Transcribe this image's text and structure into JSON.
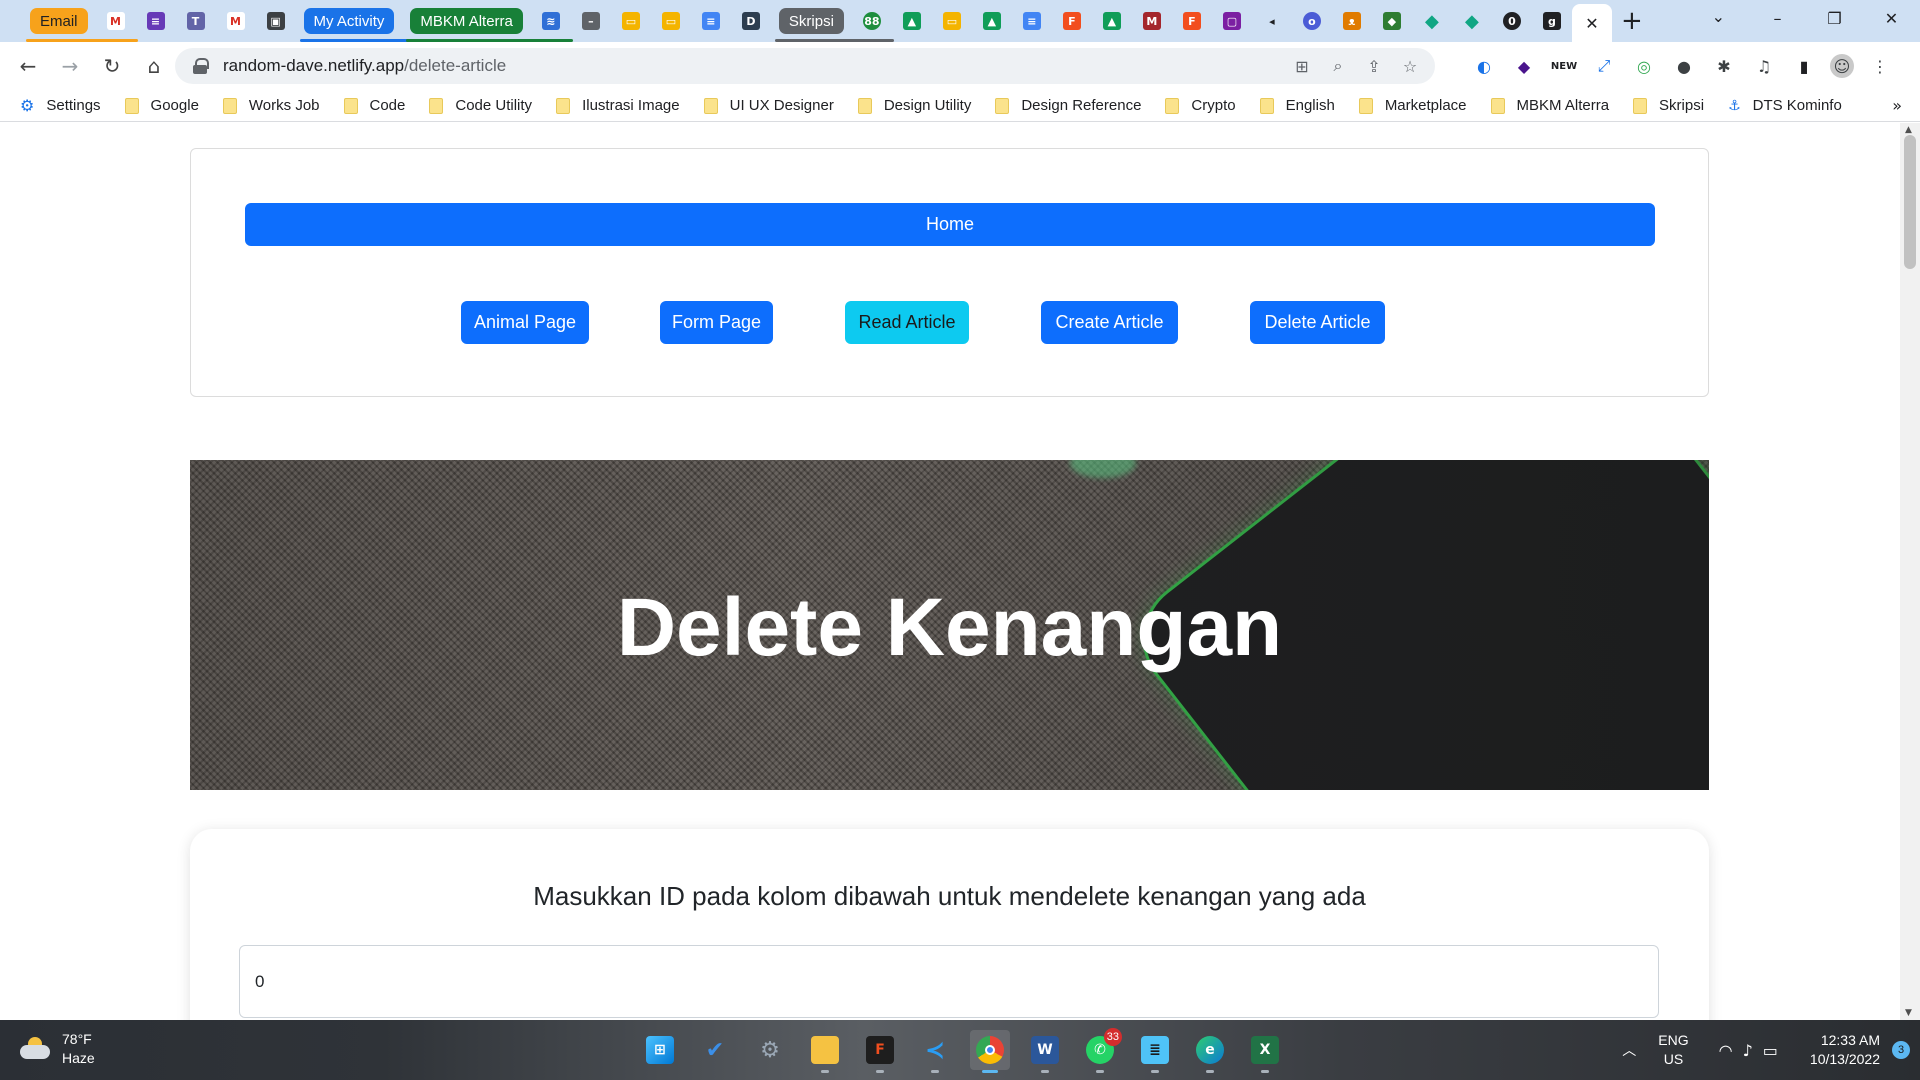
{
  "browser": {
    "tab_groups": [
      {
        "label": "Email",
        "color": "#f7a21b"
      },
      {
        "label": "My Activity",
        "color": "#1a73e8"
      },
      {
        "label": "MBKM Alterra",
        "color": "#188038"
      },
      {
        "label": "Skripsi",
        "color": "#5f6368"
      }
    ],
    "url_host": "random-dave.netlify.app",
    "url_path": "/delete-article"
  },
  "bookmarks": [
    {
      "label": "Settings",
      "icon": "gear-icon"
    },
    {
      "label": "Google",
      "icon": "folder-icon"
    },
    {
      "label": "Works Job",
      "icon": "folder-icon"
    },
    {
      "label": "Code",
      "icon": "folder-icon"
    },
    {
      "label": "Code Utility",
      "icon": "folder-icon"
    },
    {
      "label": "Ilustrasi Image",
      "icon": "folder-icon"
    },
    {
      "label": "UI UX Designer",
      "icon": "folder-icon"
    },
    {
      "label": "Design Utility",
      "icon": "folder-icon"
    },
    {
      "label": "Design Reference",
      "icon": "folder-icon"
    },
    {
      "label": "Crypto",
      "icon": "folder-icon"
    },
    {
      "label": "English",
      "icon": "folder-icon"
    },
    {
      "label": "Marketplace",
      "icon": "folder-icon"
    },
    {
      "label": "MBKM Alterra",
      "icon": "folder-icon"
    },
    {
      "label": "Skripsi",
      "icon": "folder-icon"
    },
    {
      "label": "DTS Kominfo",
      "icon": "dts-icon"
    }
  ],
  "page": {
    "nav": {
      "home": "Home",
      "buttons": [
        "Animal Page",
        "Form Page",
        "Read Article",
        "Create Article",
        "Delete Article"
      ],
      "active": "Read Article"
    },
    "hero_title": "Delete Kenangan",
    "form": {
      "instruction": "Masukkan ID pada kolom dibawah untuk mendelete kenangan yang ada",
      "id_value": "0"
    }
  },
  "taskbar": {
    "weather_temp": "78°F",
    "weather_desc": "Haze",
    "whatsapp_badge": "33",
    "lang": "ENG",
    "region": "US",
    "time": "12:33 AM",
    "date": "10/13/2022",
    "notifications": "3"
  },
  "colors": {
    "primary": "#0d6efd",
    "info": "#0dcaf0",
    "accent_green": "#36b24a"
  }
}
